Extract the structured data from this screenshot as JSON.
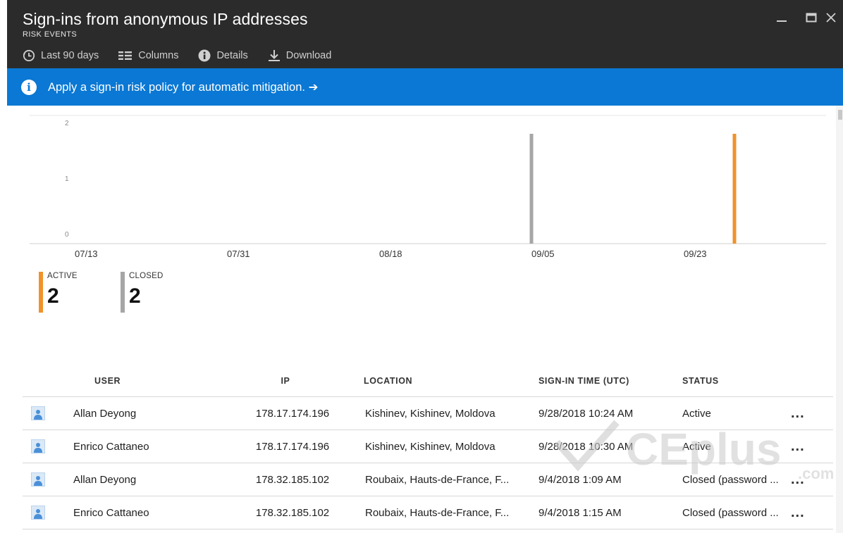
{
  "window": {
    "title": "Sign-ins from anonymous IP addresses",
    "subtitle": "RISK EVENTS"
  },
  "toolbar": {
    "items": [
      {
        "label": "Last 90 days",
        "icon": "clock-icon"
      },
      {
        "label": "Columns",
        "icon": "columns-icon"
      },
      {
        "label": "Details",
        "icon": "info-icon"
      },
      {
        "label": "Download",
        "icon": "download-icon"
      }
    ]
  },
  "banner": {
    "text": "Apply a sign-in risk policy for automatic mitigation. ➔",
    "icon": "info-icon"
  },
  "colors": {
    "header_bg": "#2b2b2b",
    "banner_bg": "#0a78d4",
    "active": "#f0922b",
    "closed": "#a6a6a6"
  },
  "chart_data": {
    "type": "bar",
    "y_ticks": [
      "2",
      "1",
      "0"
    ],
    "x_ticks": [
      "07/13",
      "07/31",
      "08/18",
      "09/05",
      "09/23"
    ],
    "ylim": [
      0,
      2
    ],
    "series": [
      {
        "name": "CLOSED",
        "color": "#a6a6a6",
        "points": [
          {
            "x": "09/04",
            "y": 2
          }
        ]
      },
      {
        "name": "ACTIVE",
        "color": "#f0922b",
        "points": [
          {
            "x": "09/28",
            "y": 2
          }
        ]
      }
    ]
  },
  "summary": {
    "active_label": "ACTIVE",
    "active_value": "2",
    "closed_label": "CLOSED",
    "closed_value": "2"
  },
  "table": {
    "headers": {
      "user": "USER",
      "ip": "IP",
      "location": "LOCATION",
      "time": "SIGN-IN TIME (UTC)",
      "status": "STATUS"
    },
    "rows": [
      {
        "user": "Allan Deyong",
        "ip": "178.17.174.196",
        "location": "Kishinev, Kishinev, Moldova",
        "time": "9/28/2018 10:24 AM",
        "status": "Active",
        "more": "..."
      },
      {
        "user": "Enrico Cattaneo",
        "ip": "178.17.174.196",
        "location": "Kishinev, Kishinev, Moldova",
        "time": "9/28/2018 10:30 AM",
        "status": "Active",
        "more": "..."
      },
      {
        "user": "Allan Deyong",
        "ip": "178.32.185.102",
        "location": "Roubaix, Hauts-de-France, F...",
        "time": "9/4/2018 1:09 AM",
        "status": "Closed (password ...",
        "more": "..."
      },
      {
        "user": "Enrico Cattaneo",
        "ip": "178.32.185.102",
        "location": "Roubaix, Hauts-de-France, F...",
        "time": "9/4/2018 1:15 AM",
        "status": "Closed (password ...",
        "more": "..."
      }
    ]
  },
  "watermark": {
    "text": "CEplus",
    "subtext": ".com"
  }
}
